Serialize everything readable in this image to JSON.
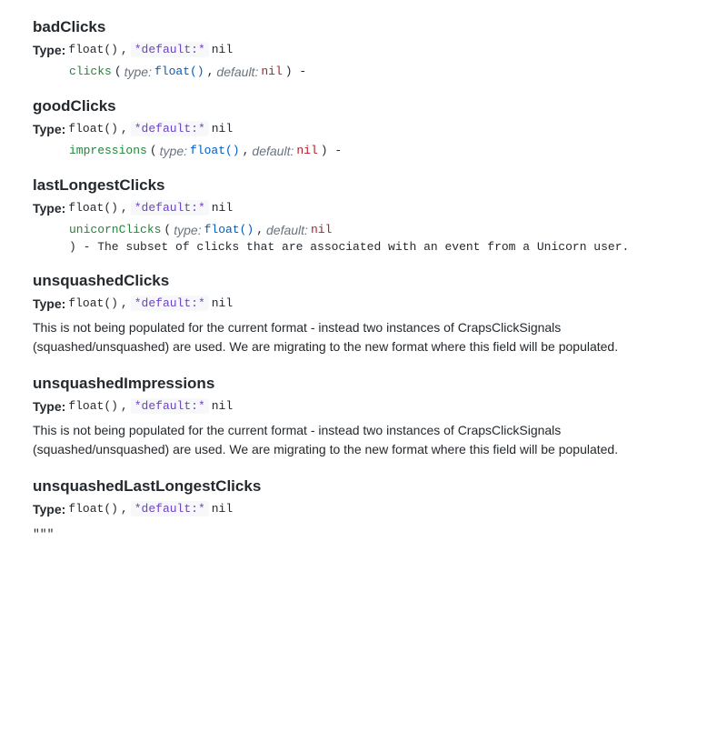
{
  "sections": [
    {
      "id": "badClicks",
      "title": "badClicks",
      "type_prefix": "Type:",
      "type_value": "float()",
      "default_label": "*default:*",
      "default_value": "nil",
      "params": [
        {
          "name": "clicks",
          "type_label": "type:",
          "type_value": "float()",
          "default_label": "default:",
          "default_value": "nil",
          "suffix": "-"
        }
      ],
      "description": null
    },
    {
      "id": "goodClicks",
      "title": "goodClicks",
      "type_prefix": "Type:",
      "type_value": "float()",
      "default_label": "*default:*",
      "default_value": "nil",
      "params": [
        {
          "name": "impressions",
          "type_label": "type:",
          "type_value": "float()",
          "default_label": "default:",
          "default_value": "nil",
          "suffix": "-"
        }
      ],
      "description": null
    },
    {
      "id": "lastLongestClicks",
      "title": "lastLongestClicks",
      "type_prefix": "Type:",
      "type_value": "float()",
      "default_label": "*default:*",
      "default_value": "nil",
      "params": [
        {
          "name": "unicornClicks",
          "type_label": "type:",
          "type_value": "float()",
          "default_label": "default:",
          "default_value": "nil",
          "suffix": "- The subset of clicks that are associated with an event from a Unicorn user."
        }
      ],
      "description": null
    },
    {
      "id": "unsquashedClicks",
      "title": "unsquashedClicks",
      "type_prefix": "Type:",
      "type_value": "float()",
      "default_label": "*default:*",
      "default_value": "nil",
      "params": [],
      "description": "This is not being populated for the current format - instead two instances of CrapsClickSignals (squashed/unsquashed) are used. We are migrating to the new format where this field will be populated."
    },
    {
      "id": "unsquashedImpressions",
      "title": "unsquashedImpressions",
      "type_prefix": "Type:",
      "type_value": "float()",
      "default_label": "*default:*",
      "default_value": "nil",
      "params": [],
      "description": "This is not being populated for the current format - instead two instances of CrapsClickSignals (squashed/unsquashed) are used. We are migrating to the new format where this field will be populated."
    },
    {
      "id": "unsquashedLastLongestClicks",
      "title": "unsquashedLastLongestClicks",
      "type_prefix": "Type:",
      "type_value": "float()",
      "default_label": "*default:*",
      "default_value": "nil",
      "params": [],
      "description": "\"\"\""
    }
  ]
}
